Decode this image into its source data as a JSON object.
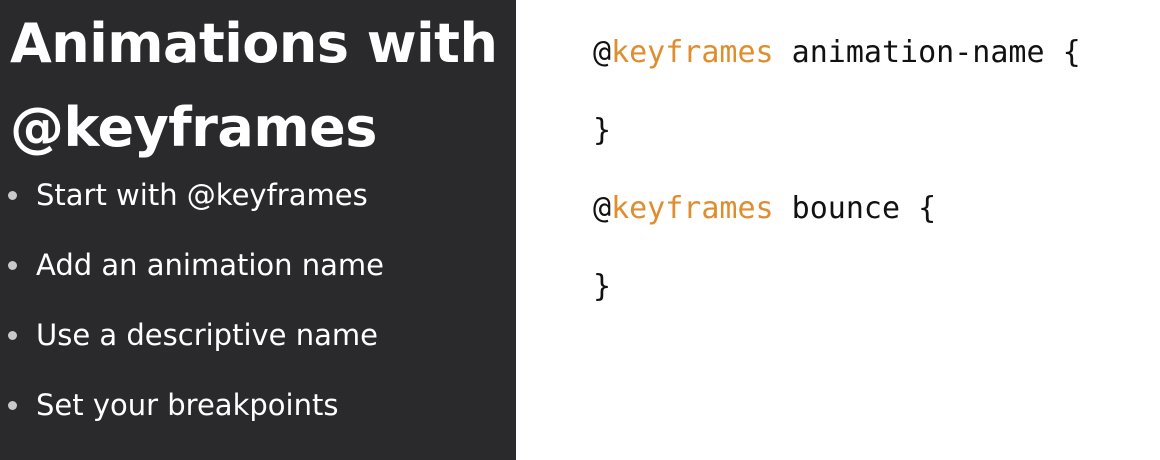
{
  "slide": {
    "title_line1": "Animations with",
    "title_line2": "@keyframes",
    "bullets": [
      "Start with @keyframes",
      "Add an animation name",
      "Use a descriptive name",
      "Set your breakpoints"
    ]
  },
  "code": {
    "line1": {
      "at": "@",
      "keyword": "keyframes",
      "rest": " animation-name {"
    },
    "line2": "}",
    "line3": {
      "at": "@",
      "keyword": "keyframes",
      "rest": " bounce {"
    },
    "line4": "}"
  },
  "colors": {
    "left_background": "#2a2a2c",
    "keyword": "#e08d2e",
    "text_light": "#ffffff",
    "code_text": "#111111"
  }
}
